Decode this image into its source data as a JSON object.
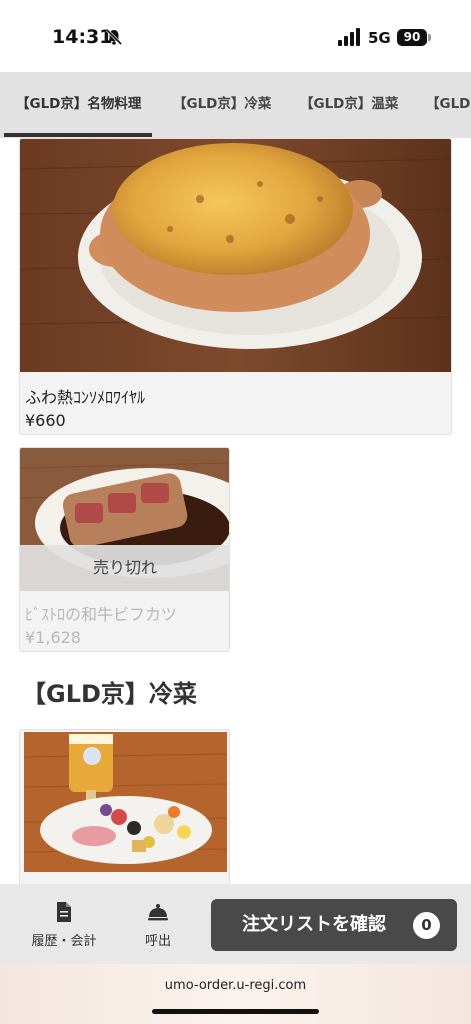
{
  "status_bar": {
    "time": "14:31",
    "network": "5G",
    "battery": "90"
  },
  "tabs": [
    {
      "label": "【GLD京】名物料理",
      "active": true
    },
    {
      "label": "【GLD京】冷菜",
      "active": false
    },
    {
      "label": "【GLD京】温菜",
      "active": false
    },
    {
      "label": "【GLD京】",
      "active": false
    }
  ],
  "items": [
    {
      "name": "ふわ熱ｺﾝｿﾒﾛﾜｲﾔﾙ",
      "price": "¥660",
      "sold_out": false
    },
    {
      "name": "ﾋﾞｽﾄﾛの和牛ビフカツ",
      "price": "¥1,628",
      "sold_out": true,
      "sold_out_label": "売り切れ"
    }
  ],
  "section": {
    "title": "【GLD京】冷菜"
  },
  "bottom_bar": {
    "history_label": "履歴・会計",
    "history_icon": "document-icon",
    "call_label": "呼出",
    "call_icon": "bell-icon",
    "order_label": "注文リストを確認",
    "order_count": "0"
  },
  "browser": {
    "url": "umo-order.u-regi.com"
  }
}
